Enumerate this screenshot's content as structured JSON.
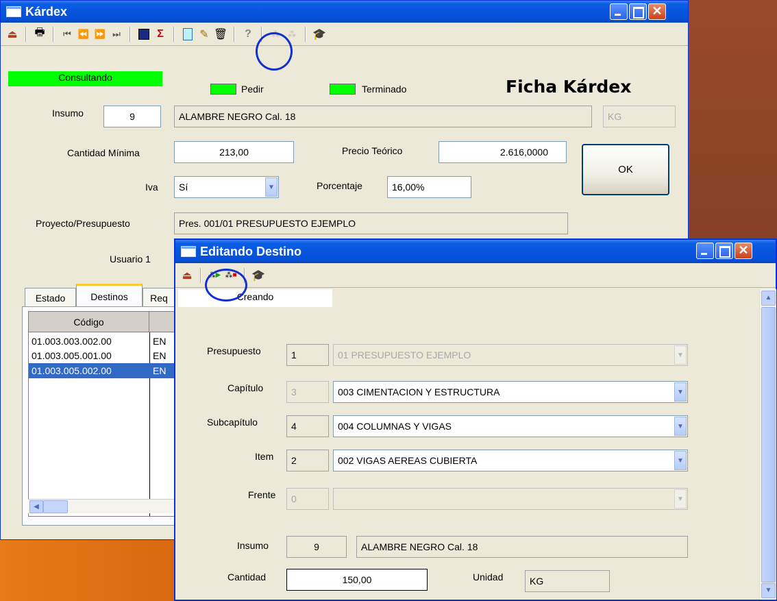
{
  "kardex": {
    "title": "Kárdex",
    "status": "Consultando",
    "legend": {
      "pedir": "Pedir",
      "terminado": "Terminado"
    },
    "heading": "Ficha Kárdex",
    "insumo": {
      "label": "Insumo",
      "code": "9",
      "name": "ALAMBRE NEGRO  Cal. 18",
      "unit": "KG"
    },
    "cantidad_minima": {
      "label": "Cantidad Mínima",
      "value": "213,00"
    },
    "precio_teorico": {
      "label": "Precio Teórico",
      "value": "2.616,0000"
    },
    "iva": {
      "label": "Iva",
      "value": "Sí"
    },
    "porcentaje": {
      "label": "Porcentaje",
      "value": "16,00%"
    },
    "proyecto": {
      "label": "Proyecto/Presupuesto",
      "value": "Pres. 001/01 PRESUPUESTO EJEMPLO"
    },
    "usuario_label": "Usuario 1",
    "ok_label": "OK",
    "tabs": [
      "Estado",
      "Destinos",
      "Req"
    ],
    "grid": {
      "header": "Código",
      "rows": [
        {
          "codigo": "01.003.003.002.00",
          "col2": "EN"
        },
        {
          "codigo": "01.003.005.001.00",
          "col2": "EN"
        },
        {
          "codigo": "01.003.005.002.00",
          "col2": "EN"
        }
      ]
    }
  },
  "destino": {
    "title": "Editando Destino",
    "status": "Creando",
    "presupuesto": {
      "label": "Presupuesto",
      "num": "1",
      "value": "01 PRESUPUESTO EJEMPLO"
    },
    "capitulo": {
      "label": "Capítulo",
      "num": "3",
      "value": "003  CIMENTACION Y ESTRUCTURA"
    },
    "subcapitulo": {
      "label": "Subcapítulo",
      "num": "4",
      "value": "004  COLUMNAS Y VIGAS"
    },
    "item": {
      "label": "Item",
      "num": "2",
      "value": "002  VIGAS AEREAS CUBIERTA"
    },
    "frente": {
      "label": "Frente",
      "num": "0",
      "value": ""
    },
    "insumo": {
      "label": "Insumo",
      "code": "9",
      "name": "ALAMBRE NEGRO   Cal. 18"
    },
    "cantidad": {
      "label": "Cantidad",
      "value": "150,00"
    },
    "unidad": {
      "label": "Unidad",
      "value": "KG"
    }
  },
  "colors": {
    "accent": "#0a5fe4",
    "status_green": "#00ff00",
    "selection": "#316ac5",
    "highlight_circle": "#1030d0"
  }
}
